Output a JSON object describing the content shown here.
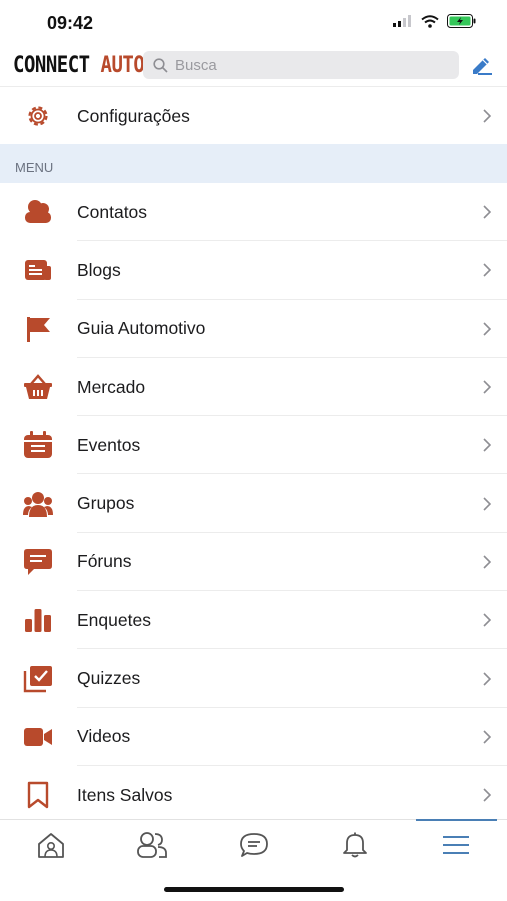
{
  "status": {
    "time": "09:42"
  },
  "header": {
    "logo": {
      "main": "CONNECT",
      "accent": "AUTO"
    },
    "search_placeholder": "Busca"
  },
  "settings": {
    "label": "Configurações"
  },
  "menu": {
    "section_label": "MENU",
    "items": [
      {
        "id": "contatos",
        "label": "Contatos",
        "icon": "contacts-icon"
      },
      {
        "id": "blogs",
        "label": "Blogs",
        "icon": "blog-icon"
      },
      {
        "id": "guia",
        "label": "Guia Automotivo",
        "icon": "flag-icon"
      },
      {
        "id": "mercado",
        "label": "Mercado",
        "icon": "basket-icon"
      },
      {
        "id": "eventos",
        "label": "Eventos",
        "icon": "calendar-icon"
      },
      {
        "id": "grupos",
        "label": "Grupos",
        "icon": "group-icon"
      },
      {
        "id": "foruns",
        "label": "Fóruns",
        "icon": "forum-icon"
      },
      {
        "id": "enquetes",
        "label": "Enquetes",
        "icon": "poll-icon"
      },
      {
        "id": "quizzes",
        "label": "Quizzes",
        "icon": "quiz-icon"
      },
      {
        "id": "videos",
        "label": "Videos",
        "icon": "video-icon"
      },
      {
        "id": "salvos",
        "label": "Itens Salvos",
        "icon": "bookmark-icon"
      }
    ]
  },
  "tabs": [
    {
      "name": "home",
      "icon": "home-icon"
    },
    {
      "name": "contacts",
      "icon": "people-icon"
    },
    {
      "name": "messages",
      "icon": "chat-icon"
    },
    {
      "name": "notifications",
      "icon": "bell-icon"
    },
    {
      "name": "menu",
      "icon": "menu-icon",
      "active": true
    }
  ],
  "colors": {
    "accent": "#b84a2c",
    "tab_active": "#4a7fb5",
    "section_bg": "#e6eef8"
  }
}
